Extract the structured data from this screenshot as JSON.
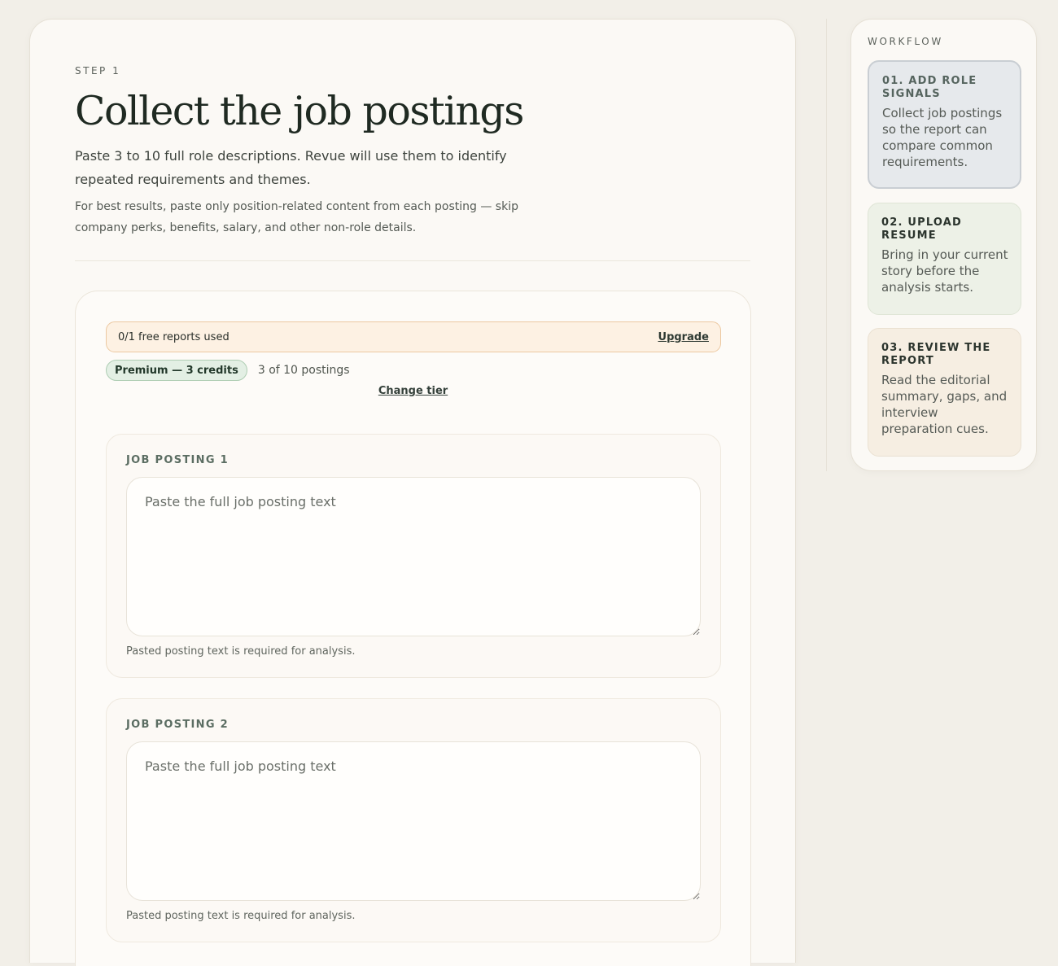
{
  "header": {
    "step_label": "STEP 1",
    "title": "Collect the job postings",
    "intro": "Paste 3 to 10 full role descriptions. Revue will use them to identify repeated requirements and themes.",
    "tip": "For best results, paste only position-related content from each posting — skip company perks, benefits, salary, and other non-role details."
  },
  "usage": {
    "text": "0/1 free reports used",
    "upgrade_label": "Upgrade"
  },
  "tier": {
    "pill_label": "Premium — 3 credits",
    "postings_count": "3 of 10 postings",
    "change_label": "Change tier"
  },
  "postings": [
    {
      "title": "JOB POSTING 1",
      "placeholder": "Paste the full job posting text",
      "value": "",
      "help": "Pasted posting text is required for analysis."
    },
    {
      "title": "JOB POSTING 2",
      "placeholder": "Paste the full job posting text",
      "value": "",
      "help": "Pasted posting text is required for analysis."
    }
  ],
  "workflow": {
    "label": "WORKFLOW",
    "steps": [
      {
        "title": "01. ADD ROLE SIGNALS",
        "description": "Collect job postings so the report can compare common requirements."
      },
      {
        "title": "02. UPLOAD RESUME",
        "description": "Bring in your current story before the analysis starts."
      },
      {
        "title": "03. REVIEW THE REPORT",
        "description": "Read the editorial summary, gaps, and interview preparation cues."
      }
    ]
  }
}
